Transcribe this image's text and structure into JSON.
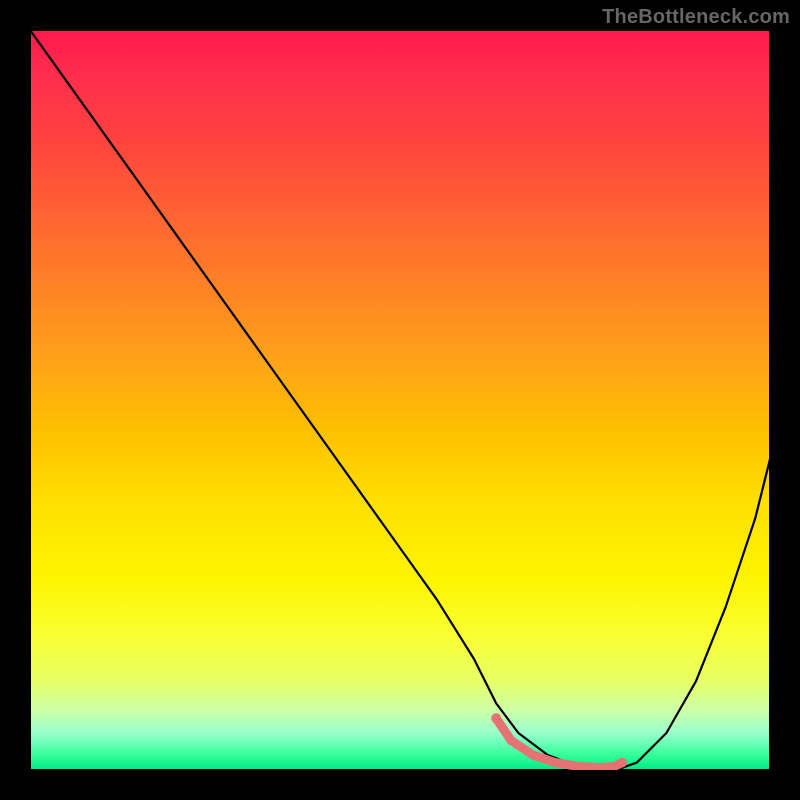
{
  "attribution": "TheBottleneck.com",
  "chart_data": {
    "type": "line",
    "title": "",
    "xlabel": "",
    "ylabel": "",
    "xlim": [
      0,
      100
    ],
    "ylim": [
      0,
      100
    ],
    "grid": false,
    "legend": false,
    "gradient_stops": [
      {
        "pos": 0.0,
        "color": "#ff1a4d"
      },
      {
        "pos": 0.06,
        "color": "#ff2d4d"
      },
      {
        "pos": 0.14,
        "color": "#ff4040"
      },
      {
        "pos": 0.24,
        "color": "#ff6033"
      },
      {
        "pos": 0.34,
        "color": "#ff8026"
      },
      {
        "pos": 0.44,
        "color": "#ffa01a"
      },
      {
        "pos": 0.54,
        "color": "#ffc000"
      },
      {
        "pos": 0.64,
        "color": "#ffe000"
      },
      {
        "pos": 0.74,
        "color": "#fff400"
      },
      {
        "pos": 0.82,
        "color": "#f9ff33"
      },
      {
        "pos": 0.88,
        "color": "#e6ff66"
      },
      {
        "pos": 0.92,
        "color": "#ccffaa"
      },
      {
        "pos": 0.95,
        "color": "#99ffcc"
      },
      {
        "pos": 0.98,
        "color": "#33ff99"
      },
      {
        "pos": 1.0,
        "color": "#00e884"
      }
    ],
    "series": [
      {
        "name": "bottleneck-curve",
        "color": "#000000",
        "x": [
          0,
          5,
          10,
          15,
          20,
          25,
          30,
          35,
          40,
          45,
          50,
          55,
          60,
          63,
          66,
          70,
          74,
          78,
          80,
          82,
          86,
          90,
          94,
          98,
          100
        ],
        "values": [
          100,
          93,
          86,
          79,
          72,
          65,
          58,
          51,
          44,
          37,
          30,
          23,
          15,
          9,
          5,
          2,
          0.5,
          0.3,
          0.3,
          1,
          5,
          12,
          22,
          34,
          42
        ]
      },
      {
        "name": "optimal-segment",
        "color": "#e57373",
        "x": [
          63,
          65,
          68,
          71,
          74,
          77,
          79,
          80
        ],
        "values": [
          7,
          4,
          2,
          1,
          0.5,
          0.3,
          0.5,
          1
        ]
      }
    ],
    "markers": [
      {
        "name": "optimal-start",
        "x": 63,
        "y": 7,
        "color": "#e57373",
        "r": 5
      },
      {
        "name": "optimal-end",
        "x": 80,
        "y": 1,
        "color": "#e57373",
        "r": 5
      }
    ]
  }
}
